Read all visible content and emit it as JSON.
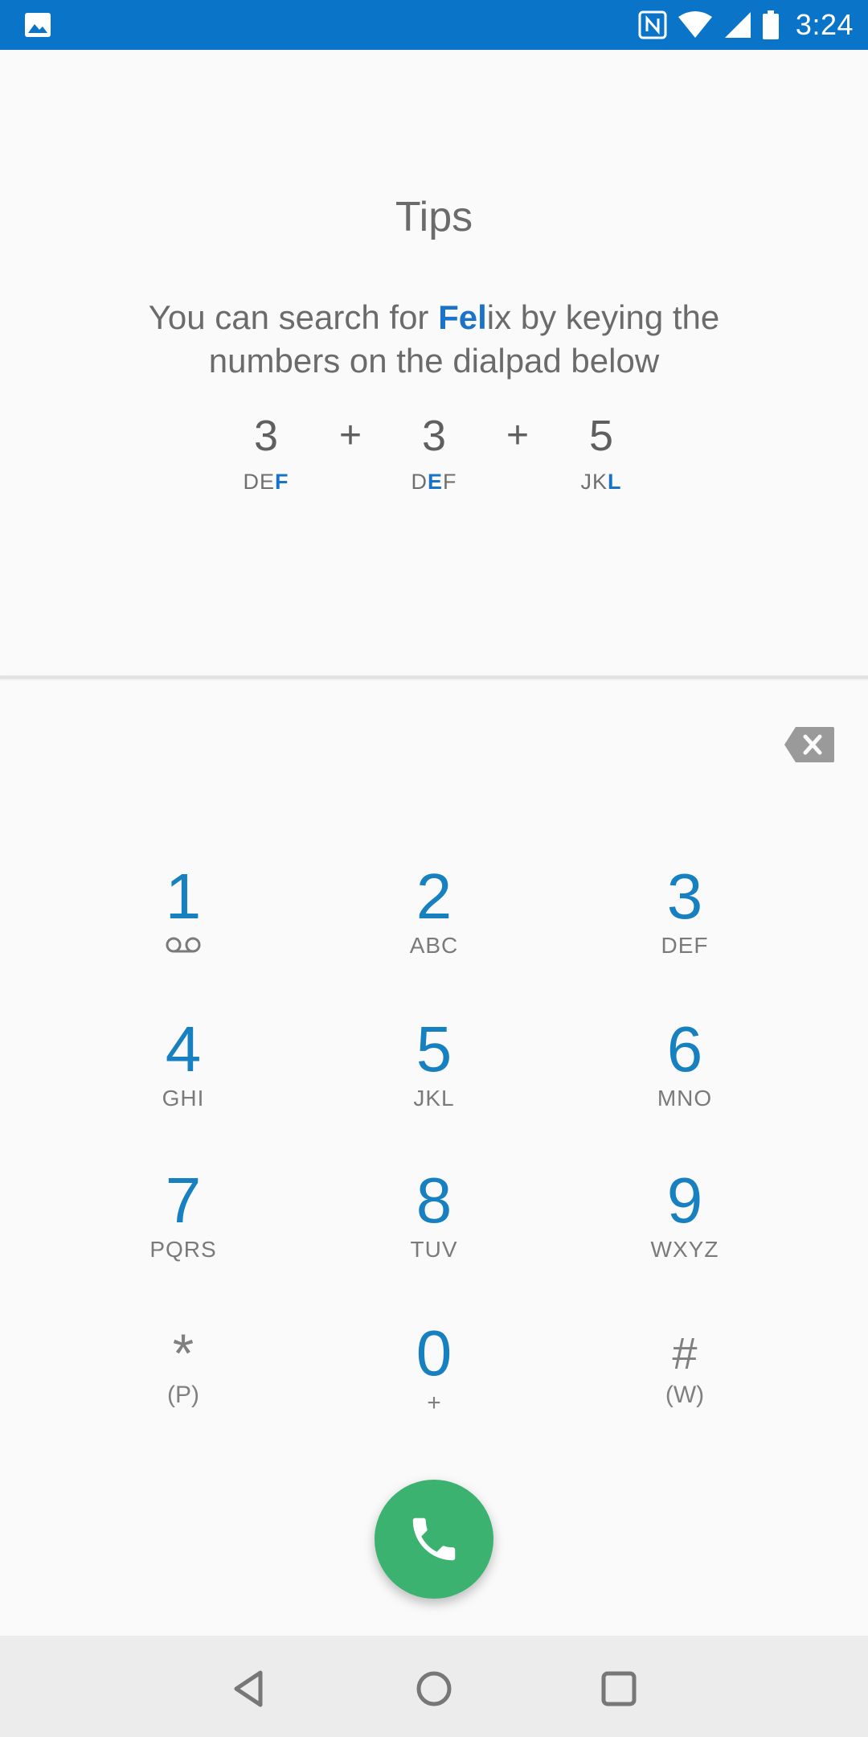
{
  "status_bar": {
    "time": "3:24",
    "icons": [
      "gallery-icon",
      "nfc-icon",
      "wifi-icon",
      "signal-icon",
      "battery-icon"
    ]
  },
  "tips": {
    "title": "Tips",
    "text_before": "You can search for ",
    "text_highlight": "Fel",
    "text_after": "ix by keying the numbers on the dialpad below",
    "sequence": [
      {
        "digit": "3",
        "letters_plain": "DE",
        "letters_highlight": "F",
        "letters_after": ""
      },
      {
        "digit": "3",
        "letters_plain": "D",
        "letters_highlight": "E",
        "letters_after": "F"
      },
      {
        "digit": "5",
        "letters_plain": "JK",
        "letters_highlight": "L",
        "letters_after": ""
      }
    ],
    "plus": "+"
  },
  "dialpad": {
    "keys": [
      {
        "digit": "1",
        "letters": ""
      },
      {
        "digit": "2",
        "letters": "ABC"
      },
      {
        "digit": "3",
        "letters": "DEF"
      },
      {
        "digit": "4",
        "letters": "GHI"
      },
      {
        "digit": "5",
        "letters": "JKL"
      },
      {
        "digit": "6",
        "letters": "MNO"
      },
      {
        "digit": "7",
        "letters": "PQRS"
      },
      {
        "digit": "8",
        "letters": "TUV"
      },
      {
        "digit": "9",
        "letters": "WXYZ"
      }
    ],
    "star": {
      "symbol": "*",
      "sub": "(P)"
    },
    "zero": {
      "digit": "0",
      "sub": "+"
    },
    "hash": {
      "symbol": "#",
      "sub": "(W)"
    }
  },
  "colors": {
    "status_bar": "#0a74c9",
    "highlight": "#1a73c8",
    "digit": "#1680c0",
    "call_button": "#3cb271"
  }
}
